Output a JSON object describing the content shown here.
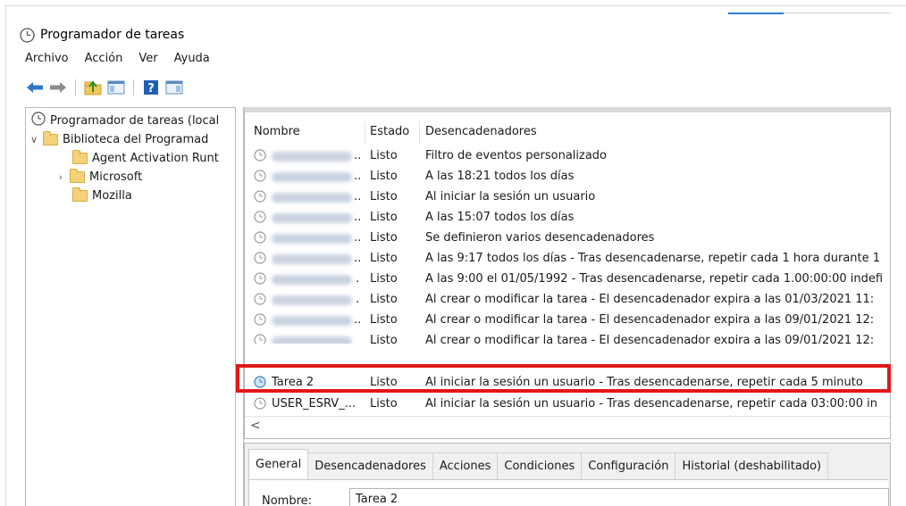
{
  "app": {
    "title": "Programador de tareas"
  },
  "menu": [
    "Archivo",
    "Acción",
    "Ver",
    "Ayuda"
  ],
  "toolbar": {
    "icons": [
      "back-arrow-icon",
      "forward-arrow-icon",
      "up-folder-icon",
      "show-hide-console-tree-icon",
      "help-icon",
      "show-hide-action-pane-icon"
    ]
  },
  "tree": {
    "root": "Programador de tareas (local",
    "library": "Biblioteca del Programad",
    "children": [
      "Agent Activation Runt",
      "Microsoft",
      "Mozilla"
    ]
  },
  "list": {
    "headers": [
      "Nombre",
      "Estado",
      "Desencadenadores"
    ],
    "rows": [
      {
        "name": "..",
        "status": "Listo",
        "trigger": "Filtro de eventos personalizado"
      },
      {
        "name": "..",
        "status": "Listo",
        "trigger": "A las 18:21 todos los días"
      },
      {
        "name": "..",
        "status": "Listo",
        "trigger": "Al iniciar la sesión un usuario"
      },
      {
        "name": "..",
        "status": "Listo",
        "trigger": "A las 15:07 todos los días"
      },
      {
        "name": "..",
        "status": "Listo",
        "trigger": "Se definieron varios desencadenadores"
      },
      {
        "name": "..",
        "status": "Listo",
        "trigger": "A las 9:17 todos los días - Tras desencadenarse, repetir cada 1 hora durante 1"
      },
      {
        "name": ".",
        "status": "Listo",
        "trigger": "A las 9:00 el 01/05/1992 - Tras desencadenarse, repetir cada 1.00:00:00 indefi"
      },
      {
        "name": ".",
        "status": "Listo",
        "trigger": "Al crear o modificar la tarea - El desencadenador expira a las 01/03/2021 11:"
      },
      {
        "name": "..",
        "status": "Listo",
        "trigger": "Al crear o modificar la tarea - El desencadenador expira a las 09/01/2021 12:"
      },
      {
        "name": "",
        "status": "Listo",
        "trigger": "Al crear o modificar la tarea - El desencadenador expira a las 09/01/2021 12:"
      },
      {
        "name": "Tarea 2",
        "status": "Listo",
        "trigger": "Al iniciar la sesión un usuario - Tras desencadenarse, repetir cada 5 minuto"
      },
      {
        "name": "USER_ESRV_...",
        "status": "Listo",
        "trigger": "Al iniciar la sesión un usuario - Tras desencadenarse, repetir cada 03:00:00 in"
      }
    ],
    "scroll_left": "<"
  },
  "details": {
    "tabs": [
      "General",
      "Desencadenadores",
      "Acciones",
      "Condiciones",
      "Configuración",
      "Historial (deshabilitado)"
    ],
    "name_label": "Nombre:",
    "name_value": "Tarea 2"
  },
  "colors": {
    "highlight": "#e01818",
    "accent": "#2d7dd2"
  }
}
